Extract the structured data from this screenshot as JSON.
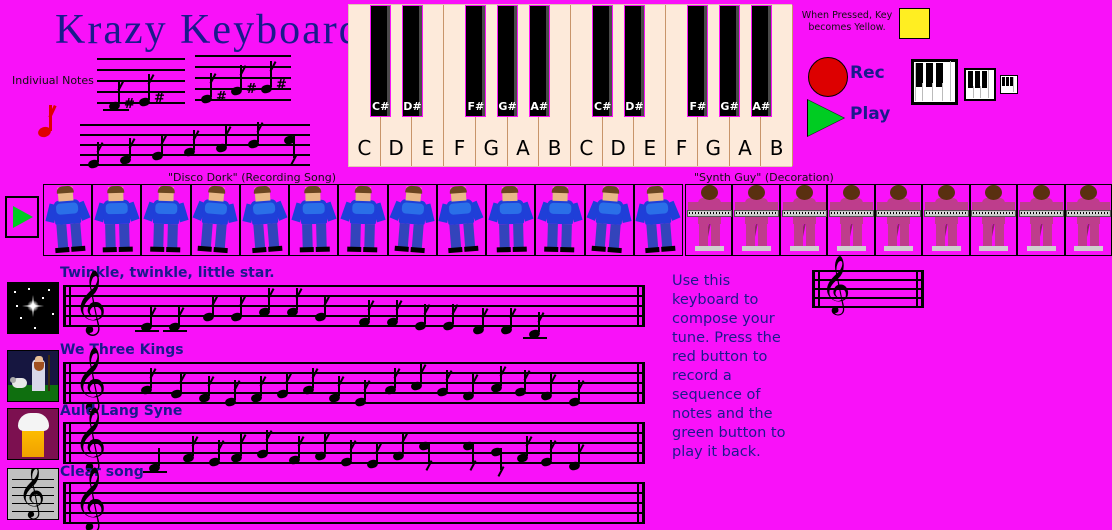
{
  "app": {
    "title": "Krazy Keyboard",
    "background_color": "#F911F9",
    "accent_color": "#1A1A8C"
  },
  "individual_notes": {
    "label": "Indiviual Notes"
  },
  "keyboard": {
    "white_keys": [
      "C",
      "D",
      "E",
      "F",
      "G",
      "A",
      "B",
      "C",
      "D",
      "E",
      "F",
      "G",
      "A",
      "B"
    ],
    "black_keys": [
      "C#",
      "D#",
      "F#",
      "G#",
      "A#",
      "C#",
      "D#",
      "F#",
      "G#",
      "A#"
    ],
    "white_key_color": "#FDEADA",
    "black_key_color": "#000000",
    "divider_color": "#C8956A"
  },
  "controls": {
    "pressed_note": "When Pressed, Key becomes Yellow.",
    "pressed_color": "#FFEE22",
    "rec_label": "Rec",
    "rec_color": "#DD0000",
    "play_label": "Play",
    "play_color": "#00CC22"
  },
  "strips": {
    "recording": {
      "title": "\"Disco Dork\" (Recording Song)",
      "frames": 13
    },
    "decoration": {
      "title": "\"Synth Guy\" (Decoration)",
      "frames": 9
    }
  },
  "songs": [
    {
      "title": "Twinkle, twinkle, little star.",
      "icon": "star-night-icon"
    },
    {
      "title": "We Three Kings",
      "icon": "shepherd-icon"
    },
    {
      "title": "Auld Lang Syne",
      "icon": "beer-mug-icon"
    },
    {
      "title": "Clear song",
      "icon": "blank-staff-icon"
    }
  ],
  "instructions": {
    "text": "Use this keyboard to compose your tune. Press the red button to record a sequence of notes and the green button to play it back."
  }
}
